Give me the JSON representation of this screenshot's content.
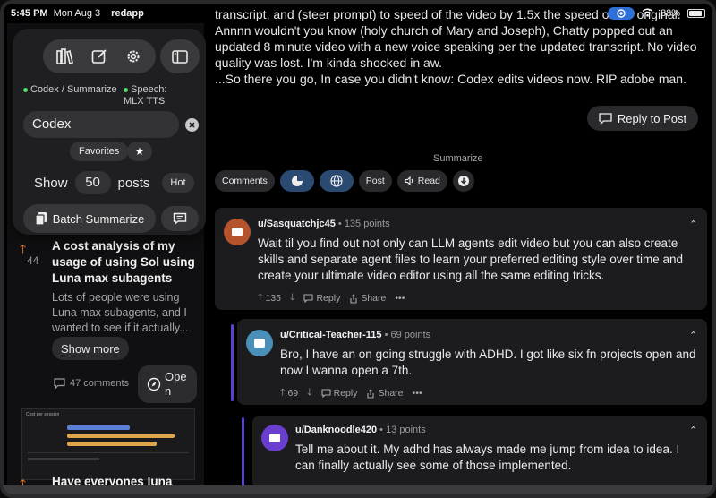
{
  "status": {
    "time": "5:45 PM",
    "date": "Mon Aug 3",
    "app": "redapp",
    "battery": "88%"
  },
  "sidebar": {
    "source_label": "Codex / Summarize",
    "speech_label": "Speech:",
    "speech_value": "MLX TTS",
    "search_value": "Codex",
    "favorites_label": "Favorites",
    "show_label": "Show",
    "show_count": "50",
    "posts_label": "posts",
    "sort_label": "Hot",
    "batch_label": "Batch Summarize"
  },
  "feed": {
    "post": {
      "votes": "44",
      "title": "A cost analysis of my usage of using Sol using Luna max subagents",
      "excerpt": "Lots of people were using Luna max subagents, and I wanted to see if it actually...",
      "show_more": "Show more",
      "comments": "47 comments",
      "open_label_1": "Ope",
      "open_label_2": "n"
    },
    "thumb_title": "Cost per session",
    "next_title": "Have everyones luna"
  },
  "main": {
    "body_lines": [
      "transcript, and (steer prompt) to speed of the video by 1.5x the speed of the original.",
      "Annnn wouldn't you know (holy church of Mary and Joseph), Chatty popped out an",
      "updated 8 minute video with a new voice speaking per the updated transcript.  No video",
      "quality was lost.  I'm kinda shocked in aw.",
      "...So there you go, In case you didn't know: Codex edits videos now.  RIP adobe man."
    ],
    "reply_label": "Reply to Post",
    "summarize_label": "Summarize",
    "actions": {
      "comments": "Comments",
      "post": "Post",
      "read": "Read"
    }
  },
  "comments": [
    {
      "user": "u/Sasquatchjc45",
      "points": "135 points",
      "text": "Wait til you find out not only can LLM agents edit video but you can also create skills and separate agent files to learn your preferred editing style over time and create your ultimate video editor using all the same editing tricks.",
      "votes": "135",
      "reply": "Reply",
      "share": "Share",
      "avatar_color": "#b5532c"
    },
    {
      "user": "u/Critical-Teacher-115",
      "points": "69 points",
      "text": "Bro, I have an on going struggle with ADHD.  I got like six fn projects open and now I wanna open a 7th.",
      "votes": "69",
      "reply": "Reply",
      "share": "Share",
      "avatar_color": "#4a8fb8"
    },
    {
      "user": "u/Danknoodle420",
      "points": "13 points",
      "text": "Tell me about it. My adhd has always made me jump from idea to idea. I can finally actually see some of those implemented.",
      "avatar_color": "#6a3fd0"
    }
  ],
  "colors": {
    "accent": "#2f6fd8",
    "upvote": "#ff7a2a",
    "thread": "#5b3fd6"
  }
}
